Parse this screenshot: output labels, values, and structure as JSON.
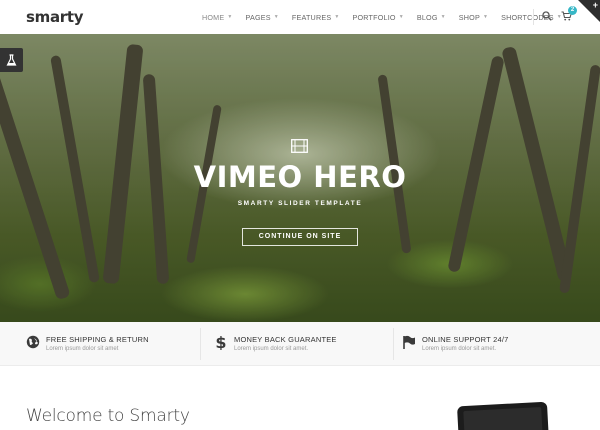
{
  "header": {
    "logo": "smarty",
    "nav": [
      {
        "label": "HOME",
        "active": true
      },
      {
        "label": "PAGES",
        "active": false
      },
      {
        "label": "FEATURES",
        "active": false
      },
      {
        "label": "PORTFOLIO",
        "active": false
      },
      {
        "label": "BLOG",
        "active": false
      },
      {
        "label": "SHOP",
        "active": false
      },
      {
        "label": "SHORTCODES",
        "active": false
      }
    ],
    "cart_count": "2",
    "accent_color": "#37b7c6"
  },
  "hero": {
    "title": "VIMEO HERO",
    "subtitle": "SMARTY SLIDER TEMPLATE",
    "button_label": "CONTINUE ON SITE",
    "icon": "film-icon"
  },
  "features": [
    {
      "icon": "globe-icon",
      "title": "FREE SHIPPING & RETURN",
      "desc": "Lorem ipsum dolor sit amet"
    },
    {
      "icon": "dollar-icon",
      "title": "MONEY BACK GUARANTEE",
      "desc": "Lorem ipsum dolor sit amet."
    },
    {
      "icon": "flag-icon",
      "title": "ONLINE SUPPORT 24/7",
      "desc": "Lorem ipsum dolor sit amet."
    }
  ],
  "welcome": {
    "heading": "Welcome to Smarty"
  }
}
